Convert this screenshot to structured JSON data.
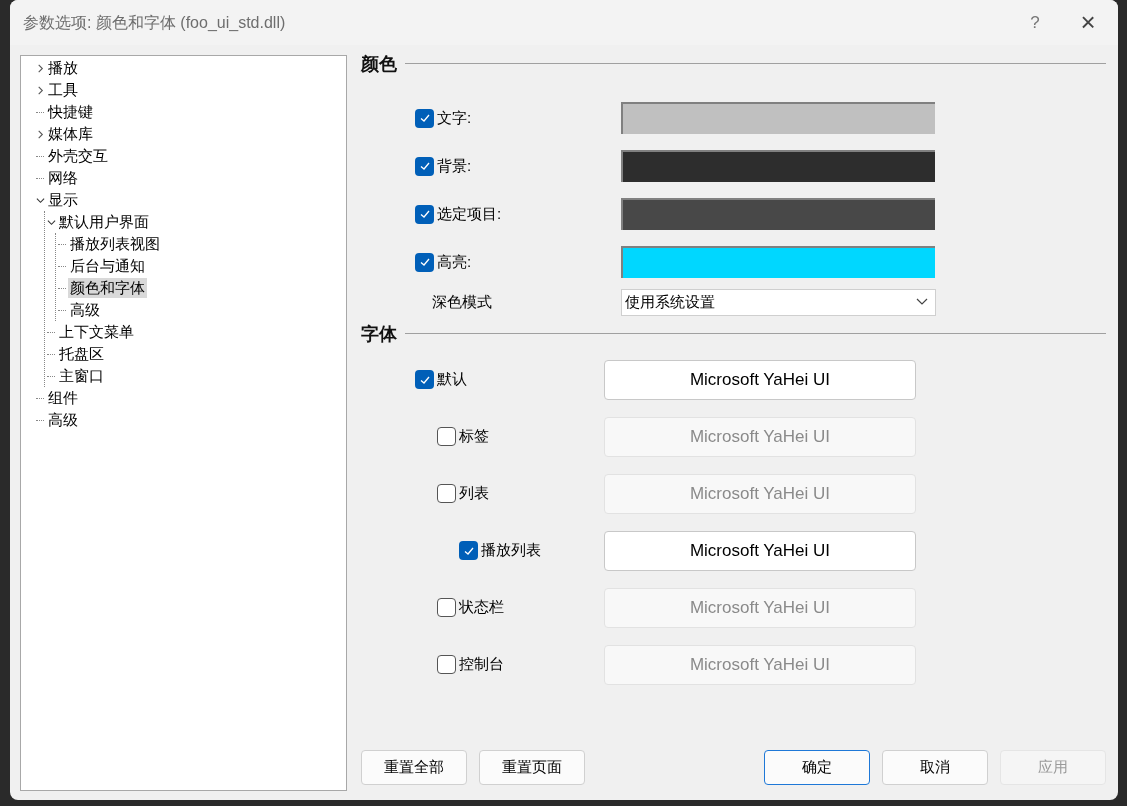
{
  "window": {
    "title": "参数选项: 颜色和字体 (foo_ui_std.dll)",
    "help": "?",
    "close": "×"
  },
  "tree": [
    {
      "label": "播放",
      "kind": "branch",
      "expanded": false,
      "selected": false
    },
    {
      "label": "工具",
      "kind": "branch",
      "expanded": false,
      "selected": false
    },
    {
      "label": "快捷键",
      "kind": "leaf",
      "selected": false
    },
    {
      "label": "媒体库",
      "kind": "branch",
      "expanded": false,
      "selected": false
    },
    {
      "label": "外壳交互",
      "kind": "leaf",
      "selected": false
    },
    {
      "label": "网络",
      "kind": "leaf",
      "selected": false
    },
    {
      "label": "显示",
      "kind": "branch",
      "expanded": true,
      "selected": false,
      "children": [
        {
          "label": "默认用户界面",
          "kind": "branch",
          "expanded": true,
          "selected": false,
          "children": [
            {
              "label": "播放列表视图",
              "kind": "leaf",
              "selected": false
            },
            {
              "label": "后台与通知",
              "kind": "leaf",
              "selected": false
            },
            {
              "label": "颜色和字体",
              "kind": "leaf",
              "selected": true
            },
            {
              "label": "高级",
              "kind": "leaf",
              "selected": false
            }
          ]
        },
        {
          "label": "上下文菜单",
          "kind": "leaf",
          "selected": false
        },
        {
          "label": "托盘区",
          "kind": "leaf",
          "selected": false
        },
        {
          "label": "主窗口",
          "kind": "leaf",
          "selected": false
        }
      ]
    },
    {
      "label": "组件",
      "kind": "leaf",
      "selected": false
    },
    {
      "label": "高级",
      "kind": "leaf",
      "selected": false
    }
  ],
  "colors": {
    "heading": "颜色",
    "rows": [
      {
        "label": "文字:",
        "checked": true,
        "color": "#c0c0c0"
      },
      {
        "label": "背景:",
        "checked": true,
        "color": "#2d2d2d"
      },
      {
        "label": "选定项目:",
        "checked": true,
        "color": "#484848"
      },
      {
        "label": "高亮:",
        "checked": true,
        "color": "#00d7ff"
      }
    ],
    "dark_mode": {
      "label": "深色模式",
      "value": "使用系统设置"
    }
  },
  "fonts": {
    "heading": "字体",
    "rows": [
      {
        "label": "默认",
        "checked": true,
        "font": "Microsoft YaHei UI",
        "children": [
          {
            "label": "标签",
            "checked": false,
            "font": "Microsoft YaHei UI"
          },
          {
            "label": "列表",
            "checked": false,
            "font": "Microsoft YaHei UI",
            "children": [
              {
                "label": "播放列表",
                "checked": true,
                "font": "Microsoft YaHei UI"
              }
            ]
          },
          {
            "label": "状态栏",
            "checked": false,
            "font": "Microsoft YaHei UI"
          },
          {
            "label": "控制台",
            "checked": false,
            "font": "Microsoft YaHei UI"
          }
        ]
      }
    ]
  },
  "buttons_left": [
    {
      "label": "重置全部",
      "kind": "normal"
    },
    {
      "label": "重置页面",
      "kind": "normal"
    }
  ],
  "buttons_right": [
    {
      "label": "确定",
      "kind": "default"
    },
    {
      "label": "取消",
      "kind": "normal"
    },
    {
      "label": "应用",
      "kind": "disabled"
    }
  ]
}
